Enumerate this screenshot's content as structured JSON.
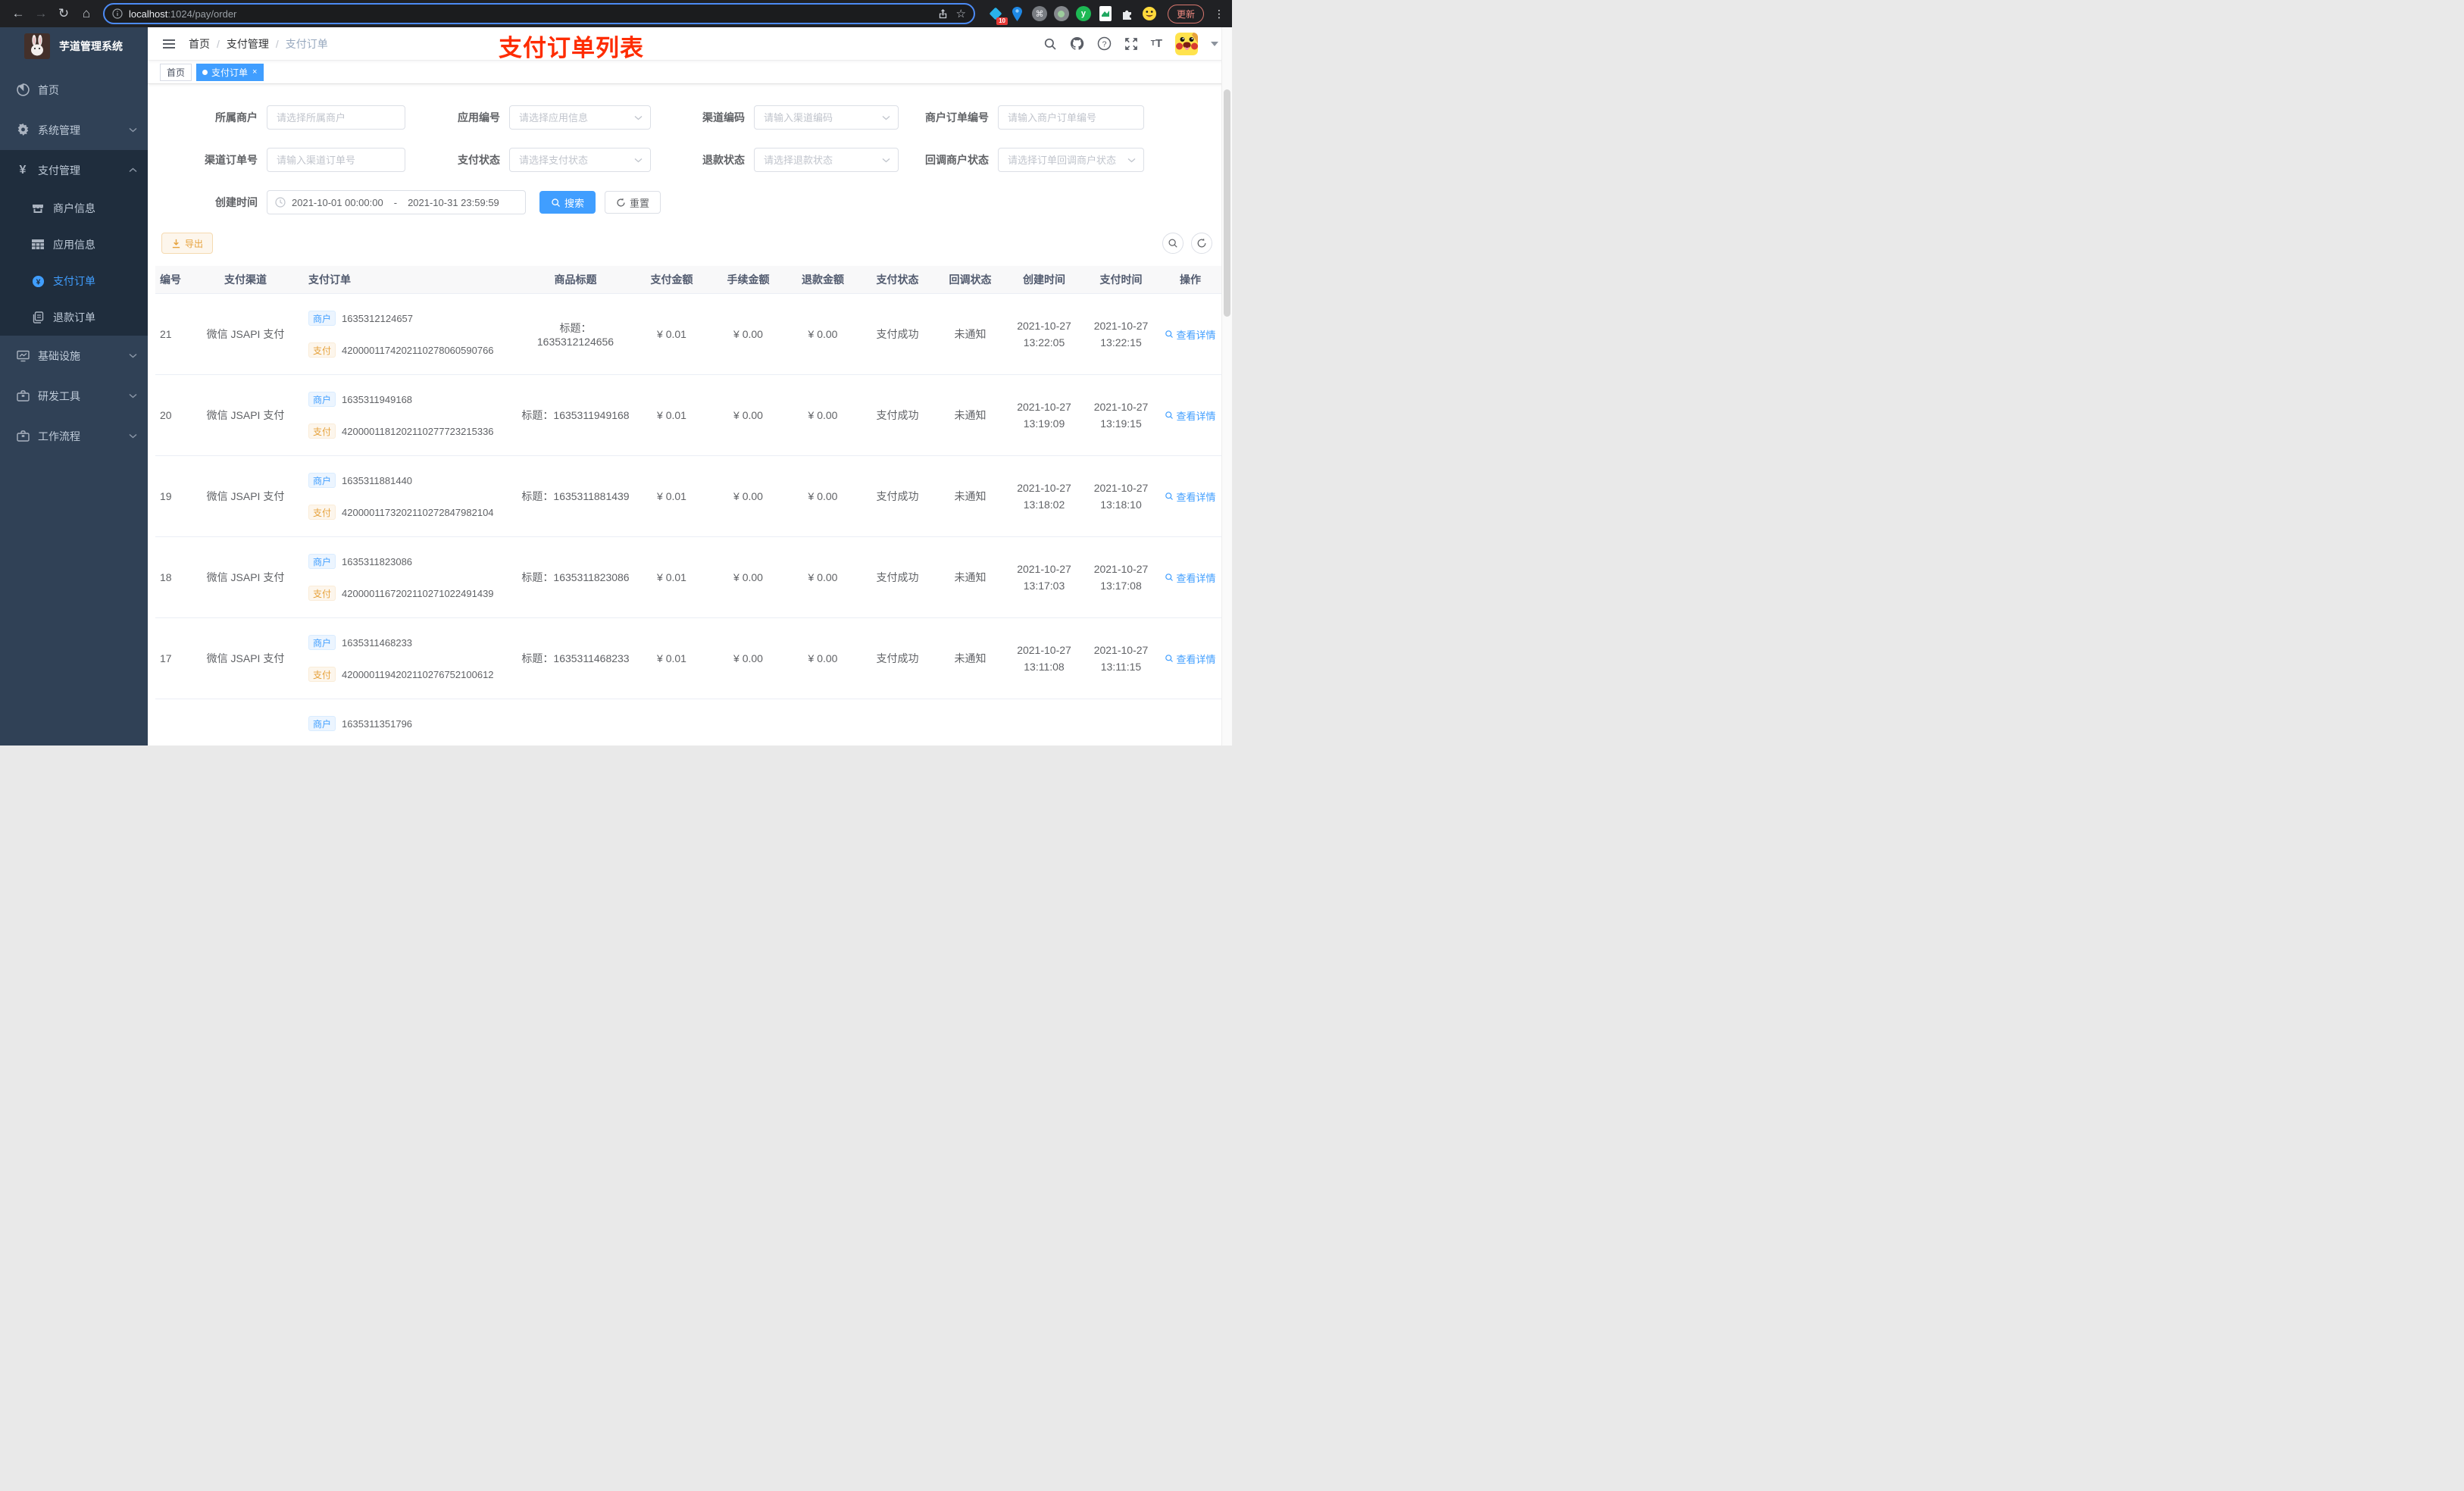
{
  "browser": {
    "url_host": "localhost",
    "url_rest": ":1024/pay/order",
    "ext_badge": "10",
    "update_label": "更新"
  },
  "sidebar": {
    "title": "芋道管理系统",
    "items": [
      {
        "label": "首页"
      },
      {
        "label": "系统管理"
      },
      {
        "label": "支付管理",
        "children": [
          {
            "label": "商户信息"
          },
          {
            "label": "应用信息"
          },
          {
            "label": "支付订单",
            "active": true
          },
          {
            "label": "退款订单"
          }
        ]
      },
      {
        "label": "基础设施"
      },
      {
        "label": "研发工具"
      },
      {
        "label": "工作流程"
      }
    ]
  },
  "navbar": {
    "breadcrumb": [
      {
        "label": "首页"
      },
      {
        "label": "支付管理"
      },
      {
        "label": "支付订单"
      }
    ],
    "separator": "/",
    "annotation": "支付订单列表"
  },
  "tabs": [
    {
      "label": "首页"
    },
    {
      "label": "支付订单",
      "active": true
    }
  ],
  "filters": {
    "items": [
      {
        "label": "所属商户",
        "placeholder": "请选择所属商户"
      },
      {
        "label": "应用编号",
        "placeholder": "请选择应用信息"
      },
      {
        "label": "渠道编码",
        "placeholder": "请输入渠道编码"
      },
      {
        "label": "商户订单编号",
        "placeholder": "请输入商户订单编号"
      },
      {
        "label": "渠道订单号",
        "placeholder": "请输入渠道订单号"
      },
      {
        "label": "支付状态",
        "placeholder": "请选择支付状态"
      },
      {
        "label": "退款状态",
        "placeholder": "请选择退款状态"
      },
      {
        "label": "回调商户状态",
        "placeholder": "请选择订单回调商户状态"
      }
    ],
    "date": {
      "label": "创建时间",
      "start": "2021-10-01 00:00:00",
      "separator": "-",
      "end": "2021-10-31 23:59:59"
    },
    "search_label": "搜索",
    "reset_label": "重置"
  },
  "toolbar": {
    "export_label": "导出"
  },
  "table": {
    "headers": [
      "编号",
      "支付渠道",
      "支付订单",
      "商品标题",
      "支付金额",
      "手续金额",
      "退款金额",
      "支付状态",
      "回调状态",
      "创建时间",
      "支付时间",
      "操作"
    ],
    "rows": [
      {
        "id": "21",
        "channel": "微信 JSAPI 支付",
        "merchant_tag": "商户",
        "merchant_no": "1635312124657",
        "pay_tag": "支付",
        "pay_no": "4200001174202110278060590766",
        "title": "标题：1635312124656",
        "amount": "¥ 0.01",
        "fee": "¥ 0.00",
        "refund": "¥ 0.00",
        "status": "支付成功",
        "notify": "未通知",
        "create_date": "2021-10-27",
        "create_time": "13:22:05",
        "pay_date": "2021-10-27",
        "pay_time": "13:22:15",
        "action": "查看详情"
      },
      {
        "id": "20",
        "channel": "微信 JSAPI 支付",
        "merchant_tag": "商户",
        "merchant_no": "1635311949168",
        "pay_tag": "支付",
        "pay_no": "4200001181202110277723215336",
        "title": "标题：1635311949168",
        "amount": "¥ 0.01",
        "fee": "¥ 0.00",
        "refund": "¥ 0.00",
        "status": "支付成功",
        "notify": "未通知",
        "create_date": "2021-10-27",
        "create_time": "13:19:09",
        "pay_date": "2021-10-27",
        "pay_time": "13:19:15",
        "action": "查看详情"
      },
      {
        "id": "19",
        "channel": "微信 JSAPI 支付",
        "merchant_tag": "商户",
        "merchant_no": "1635311881440",
        "pay_tag": "支付",
        "pay_no": "4200001173202110272847982104",
        "title": "标题：1635311881439",
        "amount": "¥ 0.01",
        "fee": "¥ 0.00",
        "refund": "¥ 0.00",
        "status": "支付成功",
        "notify": "未通知",
        "create_date": "2021-10-27",
        "create_time": "13:18:02",
        "pay_date": "2021-10-27",
        "pay_time": "13:18:10",
        "action": "查看详情"
      },
      {
        "id": "18",
        "channel": "微信 JSAPI 支付",
        "merchant_tag": "商户",
        "merchant_no": "1635311823086",
        "pay_tag": "支付",
        "pay_no": "4200001167202110271022491439",
        "title": "标题：1635311823086",
        "amount": "¥ 0.01",
        "fee": "¥ 0.00",
        "refund": "¥ 0.00",
        "status": "支付成功",
        "notify": "未通知",
        "create_date": "2021-10-27",
        "create_time": "13:17:03",
        "pay_date": "2021-10-27",
        "pay_time": "13:17:08",
        "action": "查看详情"
      },
      {
        "id": "17",
        "channel": "微信 JSAPI 支付",
        "merchant_tag": "商户",
        "merchant_no": "1635311468233",
        "pay_tag": "支付",
        "pay_no": "4200001194202110276752100612",
        "title": "标题：1635311468233",
        "amount": "¥ 0.01",
        "fee": "¥ 0.00",
        "refund": "¥ 0.00",
        "status": "支付成功",
        "notify": "未通知",
        "create_date": "2021-10-27",
        "create_time": "13:11:08",
        "pay_date": "2021-10-27",
        "pay_time": "13:11:15",
        "action": "查看详情"
      },
      {
        "id": "",
        "channel": "",
        "merchant_tag": "商户",
        "merchant_no": "1635311351796",
        "pay_tag": "",
        "pay_no": "",
        "title": "",
        "amount": "",
        "fee": "",
        "refund": "",
        "status": "",
        "notify": "",
        "create_date": "",
        "create_time": "",
        "pay_date": "",
        "pay_time": "",
        "action": ""
      }
    ]
  },
  "colors": {
    "primary": "#409eff",
    "warning": "#e6a23c",
    "annotation_red": "#fe2c00",
    "tab_active": "#409eff"
  }
}
